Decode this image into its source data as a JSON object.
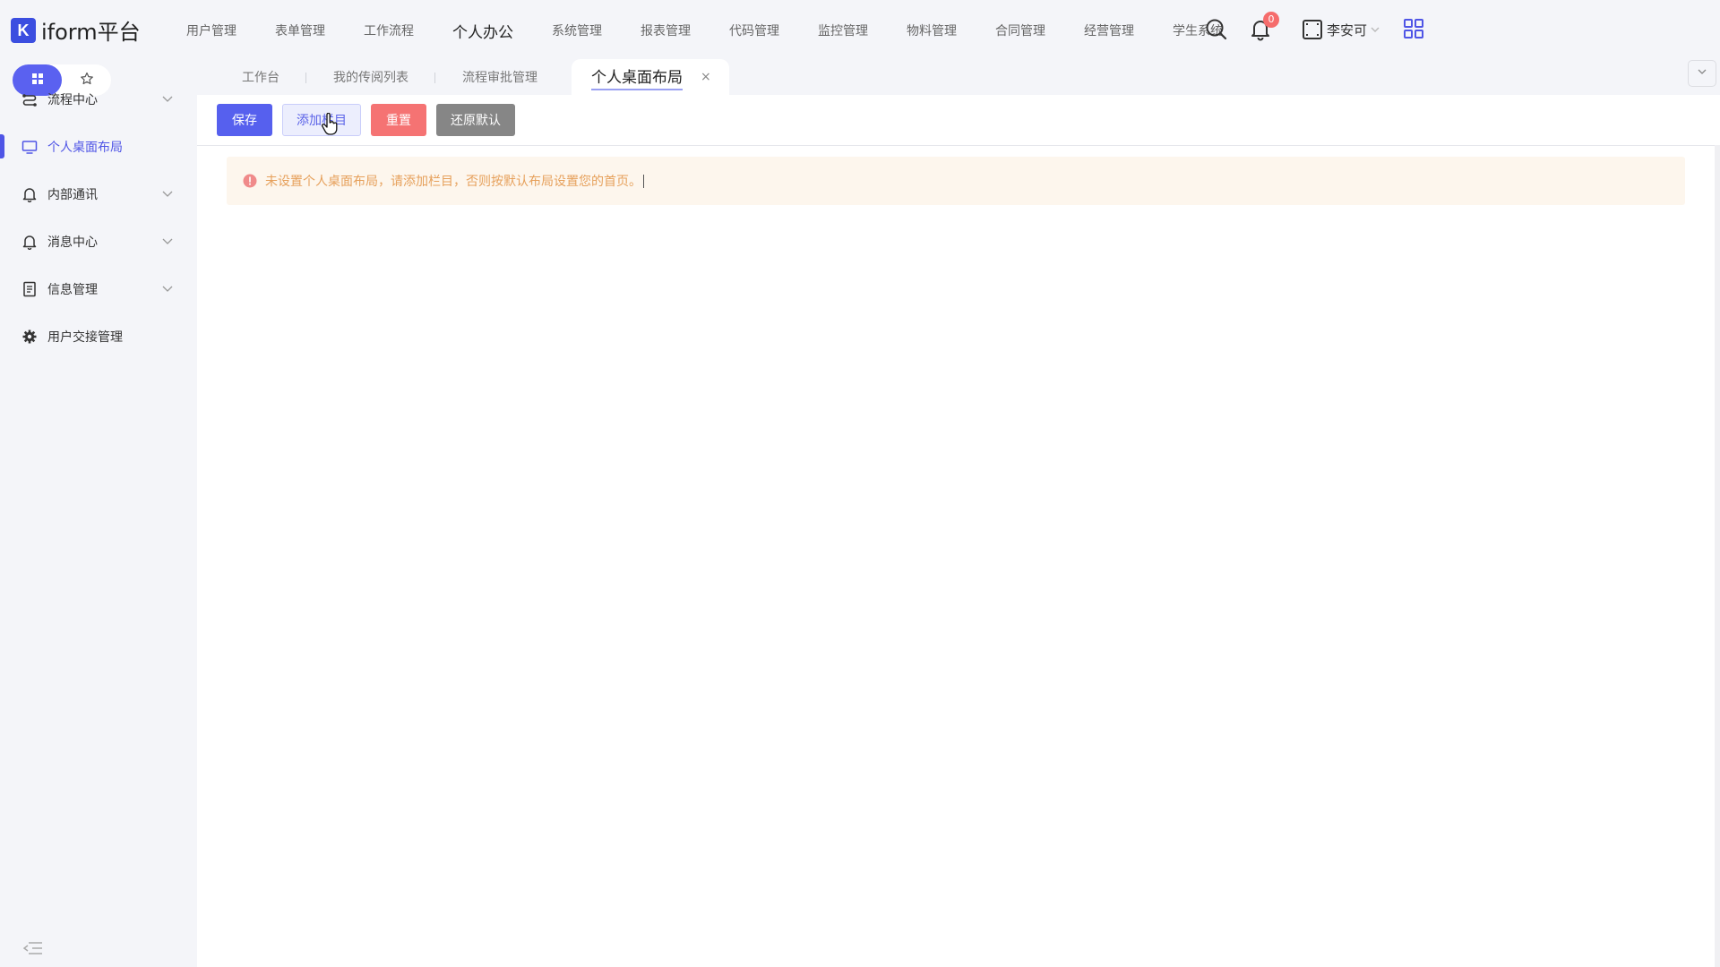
{
  "app": {
    "logo_mark": "K",
    "logo_text": "iform平台"
  },
  "top_menu": [
    {
      "label": "用户管理",
      "active": false
    },
    {
      "label": "表单管理",
      "active": false
    },
    {
      "label": "工作流程",
      "active": false
    },
    {
      "label": "个人办公",
      "active": true
    },
    {
      "label": "系统管理",
      "active": false
    },
    {
      "label": "报表管理",
      "active": false
    },
    {
      "label": "代码管理",
      "active": false
    },
    {
      "label": "监控管理",
      "active": false
    },
    {
      "label": "物料管理",
      "active": false
    },
    {
      "label": "合同管理",
      "active": false
    },
    {
      "label": "经营管理",
      "active": false
    },
    {
      "label": "学生系统",
      "active": false
    }
  ],
  "header_right": {
    "notification_count": "0",
    "username": "李安可",
    "icons": [
      "search-icon",
      "bell-icon",
      "fullscreen-icon",
      "chevron-down-icon",
      "app-grid-icon"
    ]
  },
  "sidebar": {
    "switch": [
      "grid-icon",
      "star-icon"
    ],
    "items": [
      {
        "label": "流程中心",
        "icon": "flow-icon",
        "expandable": true,
        "active": false
      },
      {
        "label": "个人桌面布局",
        "icon": "monitor-icon",
        "expandable": false,
        "active": true
      },
      {
        "label": "内部通讯",
        "icon": "bell-icon",
        "expandable": true,
        "active": false
      },
      {
        "label": "消息中心",
        "icon": "bell-icon",
        "expandable": true,
        "active": false
      },
      {
        "label": "信息管理",
        "icon": "document-icon",
        "expandable": true,
        "active": false
      },
      {
        "label": "用户交接管理",
        "icon": "gear-icon",
        "expandable": false,
        "active": false
      }
    ]
  },
  "tabs": [
    {
      "label": "工作台",
      "active": false
    },
    {
      "label": "我的传阅列表",
      "active": false
    },
    {
      "label": "流程审批管理",
      "active": false
    },
    {
      "label": "个人桌面布局",
      "active": true,
      "closable": true
    }
  ],
  "tab_close": "×",
  "toolbar": {
    "save_label": "保存",
    "add_column_label": "添加栏目",
    "reset_label": "重置",
    "restore_default_label": "还原默认"
  },
  "alert": {
    "text": "未设置个人桌面布局，请添加栏目，否则按默认布局设置您的首页。"
  },
  "colors": {
    "primary": "#5660ee",
    "danger": "#f57373",
    "gray": "#868686",
    "warning_text": "#e6a05b",
    "warning_bg": "#fdf6ed",
    "badge": "#f56c6c"
  }
}
